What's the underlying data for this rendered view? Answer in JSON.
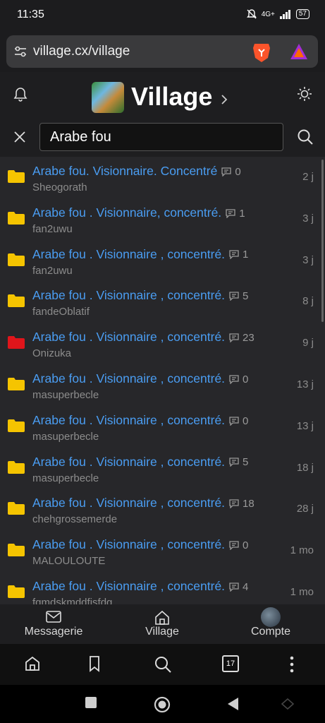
{
  "status": {
    "time": "11:35",
    "network": "4G+",
    "battery": "57"
  },
  "browser": {
    "url": "village.cx/village"
  },
  "header": {
    "title": "Village"
  },
  "search": {
    "value": "Arabe fou"
  },
  "topics": [
    {
      "title": "Arabe fou. Visionnaire. Concentré",
      "comments": "0",
      "author": "Sheogorath",
      "age": "2 j",
      "folder_color": "#f5c400"
    },
    {
      "title": "Arabe fou . Visionnaire, concentré.",
      "comments": "1",
      "author": "fan2uwu",
      "age": "3 j",
      "folder_color": "#f5c400"
    },
    {
      "title": "Arabe fou . Visionnaire , concentré.",
      "comments": "1",
      "author": "fan2uwu",
      "age": "3 j",
      "folder_color": "#f5c400"
    },
    {
      "title": "Arabe fou . Visionnaire , concentré.",
      "comments": "5",
      "author": "fandeOblatif",
      "age": "8 j",
      "folder_color": "#f5c400"
    },
    {
      "title": "Arabe fou . Visionnaire , concentré.",
      "comments": "23",
      "author": "Onizuka",
      "age": "9 j",
      "folder_color": "#e0151b"
    },
    {
      "title": "Arabe fou . Visionnaire , concentré.",
      "comments": "0",
      "author": "masuperbecle",
      "age": "13 j",
      "folder_color": "#f5c400"
    },
    {
      "title": "Arabe fou . Visionnaire , concentré.",
      "comments": "0",
      "author": "masuperbecle",
      "age": "13 j",
      "folder_color": "#f5c400"
    },
    {
      "title": "Arabe fou . Visionnaire , concentré.",
      "comments": "5",
      "author": "masuperbecle",
      "age": "18 j",
      "folder_color": "#f5c400"
    },
    {
      "title": "Arabe fou . Visionnaire , concentré.",
      "comments": "18",
      "author": "chehgrossemerde",
      "age": "28 j",
      "folder_color": "#f5c400"
    },
    {
      "title": "Arabe fou . Visionnaire , concentré.",
      "comments": "0",
      "author": "MALOULOUTE",
      "age": "1 mo",
      "folder_color": "#f5c400"
    },
    {
      "title": "Arabe fou . Visionnaire , concentré.",
      "comments": "4",
      "author": "fqmdskmddfisfdq",
      "age": "1 mo",
      "folder_color": "#f5c400"
    }
  ],
  "sitenav": {
    "messages": "Messagerie",
    "village": "Village",
    "account": "Compte"
  },
  "toolbar": {
    "tab_count": "17"
  }
}
